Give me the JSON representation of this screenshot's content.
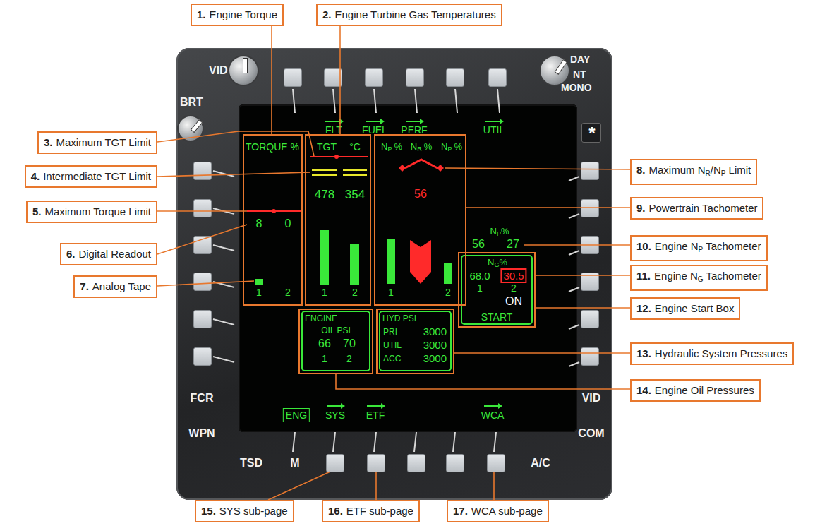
{
  "callouts": [
    {
      "num": "1.",
      "label": [
        {
          "t": "Engine Torque",
          "sub": false
        }
      ]
    },
    {
      "num": "2.",
      "label": [
        {
          "t": "Engine Turbine Gas Temperatures",
          "sub": false
        }
      ]
    },
    {
      "num": "3.",
      "label": [
        {
          "t": "Maximum TGT Limit",
          "sub": false
        }
      ]
    },
    {
      "num": "4.",
      "label": [
        {
          "t": "Intermediate TGT Limit",
          "sub": false
        }
      ]
    },
    {
      "num": "5.",
      "label": [
        {
          "t": "Maximum Torque Limit",
          "sub": false
        }
      ]
    },
    {
      "num": "6.",
      "label": [
        {
          "t": "Digital Readout",
          "sub": false
        }
      ]
    },
    {
      "num": "7.",
      "label": [
        {
          "t": "Analog Tape",
          "sub": false
        }
      ]
    },
    {
      "num": "8.",
      "label": [
        {
          "t": "Maximum N",
          "sub": false
        },
        {
          "t": "R",
          "sub": true
        },
        {
          "t": "/N",
          "sub": false
        },
        {
          "t": "P",
          "sub": true
        },
        {
          "t": " Limit",
          "sub": false
        }
      ]
    },
    {
      "num": "9.",
      "label": [
        {
          "t": "Powertrain Tachometer",
          "sub": false
        }
      ]
    },
    {
      "num": "10.",
      "label": [
        {
          "t": "Engine N",
          "sub": false
        },
        {
          "t": "P",
          "sub": true
        },
        {
          "t": " Tachometer",
          "sub": false
        }
      ]
    },
    {
      "num": "11.",
      "label": [
        {
          "t": "Engine N",
          "sub": false
        },
        {
          "t": "G",
          "sub": true
        },
        {
          "t": " Tachometer",
          "sub": false
        }
      ]
    },
    {
      "num": "12.",
      "label": [
        {
          "t": "Engine Start Box",
          "sub": false
        }
      ]
    },
    {
      "num": "13.",
      "label": [
        {
          "t": "Hydraulic System Pressures",
          "sub": false
        }
      ]
    },
    {
      "num": "14.",
      "label": [
        {
          "t": "Engine Oil Pressures",
          "sub": false
        }
      ]
    },
    {
      "num": "15.",
      "label": [
        {
          "t": "SYS sub-page",
          "sub": false
        }
      ]
    },
    {
      "num": "16.",
      "label": [
        {
          "t": "ETF sub-page",
          "sub": false
        }
      ]
    },
    {
      "num": "17.",
      "label": [
        {
          "t": "WCA sub-page",
          "sub": false
        }
      ]
    }
  ],
  "bezel": {
    "vid_knob": "VID",
    "brt_knob": "BRT",
    "mode_knob": [
      "DAY",
      "NT",
      "MONO"
    ],
    "star_key": "*",
    "side_keys": [
      "FCR",
      "WPN",
      "VID",
      "COM"
    ],
    "bottom_keys": [
      "TSD",
      "M",
      "A/C"
    ]
  },
  "screen": {
    "top_tabs": [
      {
        "label": "FLT"
      },
      {
        "label": "FUEL"
      },
      {
        "label": "PERF"
      },
      {
        "label": "UTIL"
      }
    ],
    "bottom_tabs": [
      {
        "label": "ENG",
        "selected": true
      },
      {
        "label": "SYS",
        "selected": false
      },
      {
        "label": "ETF",
        "selected": false
      },
      {
        "label": "WCA",
        "selected": false
      }
    ],
    "torque": {
      "title": "TORQUE %",
      "readouts": [
        "8",
        "0"
      ],
      "levels": [
        0.08,
        0
      ],
      "engines": [
        "1",
        "2"
      ]
    },
    "tgt": {
      "title": "TGT",
      "unit": "°C",
      "readouts": [
        "478",
        "354"
      ],
      "levels": [
        0.7,
        0.53
      ],
      "engines": [
        "1",
        "2"
      ]
    },
    "powertrain": {
      "headers": [
        {
          "n": "N",
          "sub": "P",
          "unit": "%"
        },
        {
          "n": "N",
          "sub": "R",
          "unit": "%"
        },
        {
          "n": "N",
          "sub": "P",
          "unit": "%"
        }
      ],
      "nr_readout": "56",
      "bars": [
        {
          "level": 0.58,
          "color": "#3ae83a"
        },
        {
          "level": 0.56,
          "color": "#ff2a2a"
        },
        {
          "level": 0.26,
          "color": "#3ae83a"
        }
      ],
      "engines": [
        "1",
        "2"
      ]
    },
    "np": {
      "title": {
        "n": "N",
        "sub": "P",
        "unit": "%"
      },
      "readouts": [
        "56",
        "27"
      ]
    },
    "start_box": {
      "title": {
        "n": "N",
        "sub": "G",
        "unit": "%"
      },
      "readouts": [
        {
          "value": "68.0",
          "warning": false
        },
        {
          "value": "30.5",
          "warning": true
        }
      ],
      "engines": [
        "1",
        "2"
      ],
      "state": "ON",
      "label": "START"
    },
    "oil": {
      "title": "ENGINE",
      "subtitle": "OIL PSI",
      "readouts": [
        "66",
        "70"
      ],
      "engines": [
        "1",
        "2"
      ]
    },
    "hydraulics": {
      "title": "HYD PSI",
      "rows": [
        {
          "label": "PRI",
          "value": "3000"
        },
        {
          "label": "UTIL",
          "value": "3000"
        },
        {
          "label": "ACC",
          "value": "3000"
        }
      ]
    }
  }
}
